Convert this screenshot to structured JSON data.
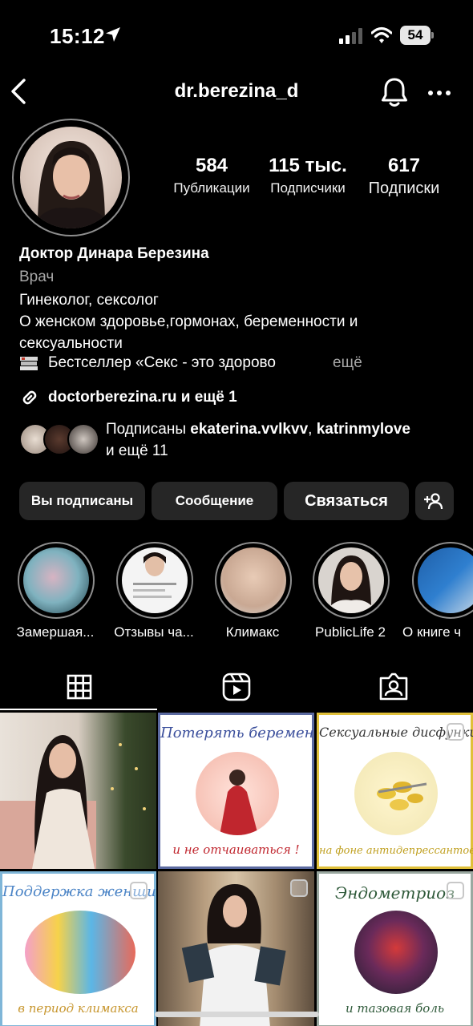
{
  "status_bar": {
    "time": "15:12",
    "battery": "54"
  },
  "header": {
    "username": "dr.berezina_d"
  },
  "profile": {
    "stats": [
      {
        "value": "584",
        "label": "Публикации"
      },
      {
        "value": "115 тыс.",
        "label": "Подписчики"
      },
      {
        "value": "617",
        "label": "Подписки"
      }
    ],
    "name": "Доктор Динара Березина",
    "category": "Врач",
    "bio_line1": "Гинеколог, сексолог",
    "bio_line2": "О женском здоровье,гормонах, беременности и сексуальности",
    "bio_line3": "Бестселлер «Секс - это здорово",
    "more": "ещё",
    "link": "doctorberezina.ru и ещё 1",
    "followed_by_prefix": "Подписаны ",
    "followed_user1": "ekaterina.vvlkvv",
    "followed_sep": ", ",
    "followed_user2": "katrinmylove",
    "followed_suffix": "и ещё 11"
  },
  "buttons": {
    "following": "Вы подписаны",
    "message": "Сообщение",
    "contact": "Связаться"
  },
  "highlights": [
    {
      "label": "Замершая..."
    },
    {
      "label": "Отзывы ча..."
    },
    {
      "label": "Климакс"
    },
    {
      "label": "PublicLife 2"
    },
    {
      "label": "О книге ч"
    }
  ],
  "posts": [
    {
      "title": "",
      "subtitle": ""
    },
    {
      "title": "Потерять беременность",
      "subtitle": "и не отчаиваться !"
    },
    {
      "title": "Сексуальные дисфункции",
      "subtitle": "на фоне антидепрессантов"
    },
    {
      "title": "Поддержка женщин",
      "subtitle": "в период климакса"
    },
    {
      "title": "",
      "subtitle": ""
    },
    {
      "title": "Эндометриоз",
      "subtitle": "и тазовая боль"
    }
  ],
  "colors": {
    "background": "#000000",
    "button": "#262626",
    "secondary_text": "#a8a8a8"
  }
}
